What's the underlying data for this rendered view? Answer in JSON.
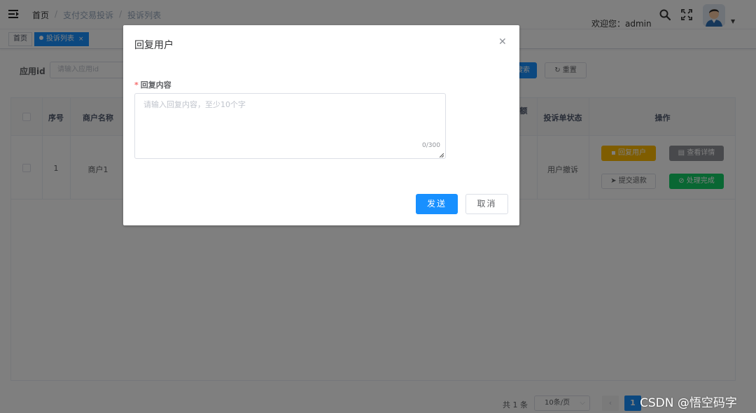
{
  "navbar": {
    "breadcrumb": [
      "首页",
      "支付交易投诉",
      "投诉列表"
    ],
    "welcome": "欢迎您：admin"
  },
  "tags": [
    {
      "label": "首页"
    },
    {
      "label": "投诉列表"
    }
  ],
  "filter": {
    "label": "应用id",
    "placeholder": "请输入应用id",
    "search_label": "搜索",
    "reset_label": "重置"
  },
  "table": {
    "headers": [
      "序号",
      "商户名称",
      "额",
      "投诉单状态",
      "操作"
    ],
    "rows": [
      {
        "index": "1",
        "merchant": "商户1",
        "status": "用户撤诉",
        "actions": [
          "回复用户",
          "查看详情",
          "提交退款",
          "处理完成"
        ]
      }
    ]
  },
  "pagination": {
    "total": "共 1 条",
    "page_size": "10条/页",
    "current": "1"
  },
  "dialog": {
    "title": "回复用户",
    "field_label": "回复内容",
    "placeholder": "请输入回复内容，至少10个字",
    "counter": "0/300",
    "send_label": "发送",
    "cancel_label": "取消"
  },
  "watermark": "CSDN @悟空码字",
  "colors": {
    "primary": "#1890ff",
    "warning": "#ffba00",
    "info": "#909399",
    "success": "#13ce66",
    "required": "#f56c6c"
  },
  "icons": {
    "navbar": [
      "hamburger-icon",
      "search-icon",
      "fullscreen-icon",
      "avatar",
      "caret-down-icon"
    ],
    "dialog": [
      "close-icon"
    ]
  }
}
